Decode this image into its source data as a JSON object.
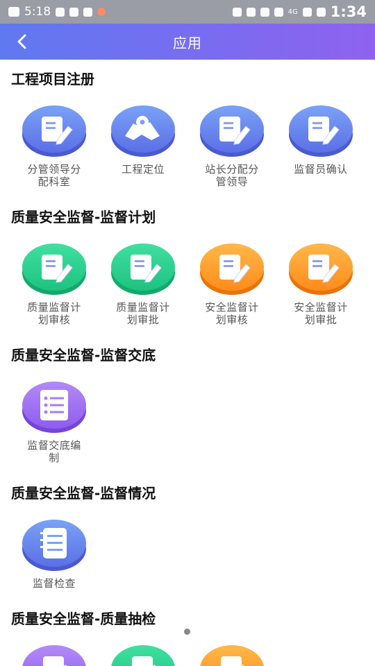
{
  "status_bar": {
    "time_left": "5:18",
    "network": "4G",
    "time_right": "1:34"
  },
  "app_bar": {
    "title": "应用"
  },
  "colors": {
    "header_start": "#5f79f0",
    "header_end": "#8f62ef",
    "blue": "#6f8fef",
    "green": "#28cf8e",
    "orange": "#ff9f2f",
    "purple": "#9b6cf2"
  },
  "sections": [
    {
      "title": "工程项目注册",
      "items": [
        {
          "label": "分管领导分配科室",
          "icon": "document-edit-icon",
          "color": "blue"
        },
        {
          "label": "工程定位",
          "icon": "map-location-icon",
          "color": "blue"
        },
        {
          "label": "站长分配分管领导",
          "icon": "document-edit-icon",
          "color": "blue"
        },
        {
          "label": "监督员确认",
          "icon": "document-edit-icon",
          "color": "blue"
        }
      ]
    },
    {
      "title": "质量安全监督-监督计划",
      "items": [
        {
          "label": "质量监督计划审核",
          "icon": "document-edit-icon",
          "color": "green"
        },
        {
          "label": "质量监督计划审批",
          "icon": "document-edit-icon",
          "color": "green"
        },
        {
          "label": "安全监督计划审核",
          "icon": "document-edit-icon",
          "color": "orange"
        },
        {
          "label": "安全监督计划审批",
          "icon": "document-edit-icon",
          "color": "orange"
        }
      ]
    },
    {
      "title": "质量安全监督-监督交底",
      "items": [
        {
          "label": "监督交底编制",
          "icon": "checklist-icon",
          "color": "purple"
        }
      ]
    },
    {
      "title": "质量安全监督-监督情况",
      "items": [
        {
          "label": "监督检查",
          "icon": "notebook-icon",
          "color": "blue"
        }
      ]
    },
    {
      "title": "质量安全监督-质量抽检",
      "items": [
        {
          "label": "",
          "icon": "edit-icon",
          "color": "purple"
        },
        {
          "label": "",
          "icon": "edit-icon",
          "color": "green"
        },
        {
          "label": "",
          "icon": "edit-icon",
          "color": "orange"
        }
      ]
    }
  ]
}
